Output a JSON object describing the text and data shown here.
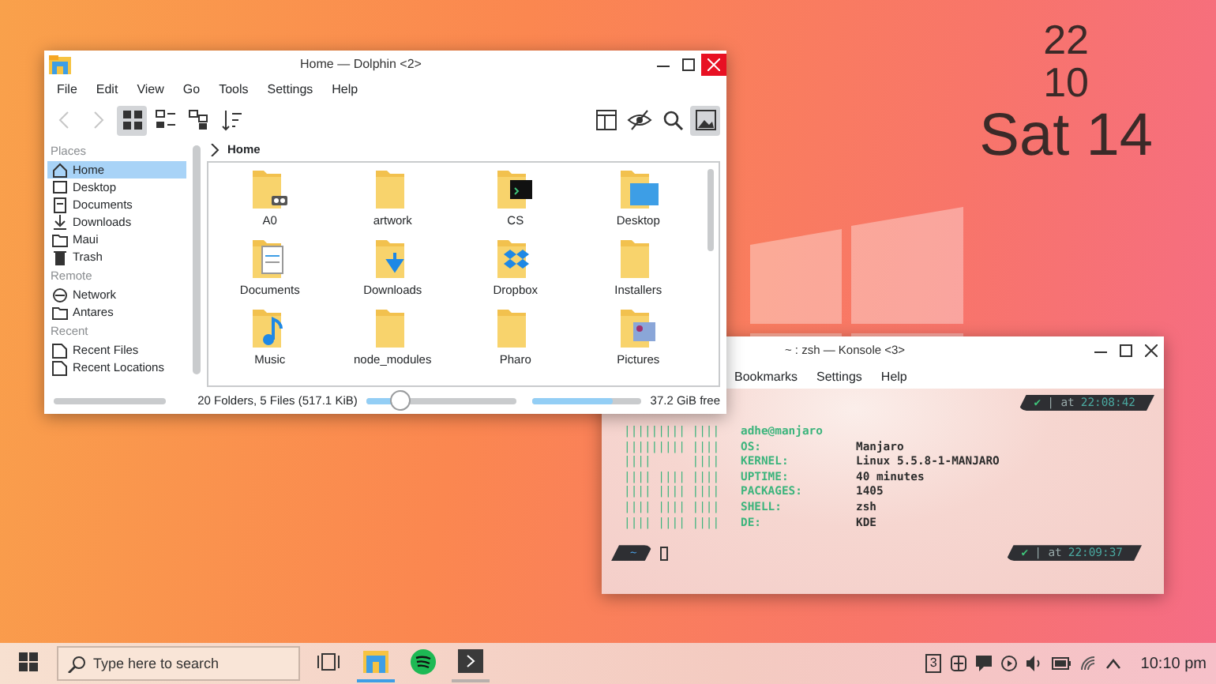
{
  "desktop_clock": {
    "hour": "22",
    "minute": "10",
    "date": "Sat 14"
  },
  "dolphin": {
    "title": "Home — Dolphin <2>",
    "menu": [
      "File",
      "Edit",
      "View",
      "Go",
      "Tools",
      "Settings",
      "Help"
    ],
    "toolbar": [
      {
        "kind": "back",
        "disabled": true,
        "selected": false
      },
      {
        "kind": "forward",
        "disabled": true,
        "selected": false
      },
      {
        "kind": "icons-view",
        "disabled": false,
        "selected": true
      },
      {
        "kind": "compact-view",
        "disabled": false,
        "selected": false
      },
      {
        "kind": "details-view",
        "disabled": false,
        "selected": false
      },
      {
        "kind": "sort",
        "disabled": false,
        "selected": false
      },
      {
        "kind": "spacer"
      },
      {
        "kind": "split",
        "disabled": false,
        "selected": false
      },
      {
        "kind": "hidden",
        "disabled": false,
        "selected": false
      },
      {
        "kind": "search",
        "disabled": false,
        "selected": false
      },
      {
        "kind": "preview",
        "disabled": false,
        "selected": true
      }
    ],
    "places": [
      {
        "heading": "Places",
        "items": [
          {
            "label": "Home",
            "kind": "home",
            "selected": true
          },
          {
            "label": "Desktop",
            "kind": "desktop",
            "selected": false
          },
          {
            "label": "Documents",
            "kind": "documents",
            "selected": false
          },
          {
            "label": "Downloads",
            "kind": "downloads",
            "selected": false
          },
          {
            "label": "Maui",
            "kind": "folder",
            "selected": false
          },
          {
            "label": "Trash",
            "kind": "trash",
            "selected": false
          }
        ]
      },
      {
        "heading": "Remote",
        "items": [
          {
            "label": "Network",
            "kind": "network",
            "selected": false
          },
          {
            "label": "Antares",
            "kind": "folder",
            "selected": false
          }
        ]
      },
      {
        "heading": "Recent",
        "items": [
          {
            "label": "Recent Files",
            "kind": "recent",
            "selected": false
          },
          {
            "label": "Recent Locations",
            "kind": "recent",
            "selected": false
          }
        ]
      }
    ],
    "breadcrumb": "Home",
    "files": [
      {
        "name": "A0",
        "kind": "archive"
      },
      {
        "name": "artwork",
        "kind": "folder"
      },
      {
        "name": "CS",
        "kind": "terminal"
      },
      {
        "name": "Desktop",
        "kind": "desktop"
      },
      {
        "name": "Documents",
        "kind": "documents"
      },
      {
        "name": "Downloads",
        "kind": "downloads"
      },
      {
        "name": "Dropbox",
        "kind": "dropbox"
      },
      {
        "name": "Installers",
        "kind": "folder"
      },
      {
        "name": "Music",
        "kind": "music"
      },
      {
        "name": "node_modules",
        "kind": "folder"
      },
      {
        "name": "Pharo",
        "kind": "folder"
      },
      {
        "name": "Pictures",
        "kind": "pictures"
      }
    ],
    "status": "20 Folders, 5 Files (517.1 KiB)",
    "zoom": {
      "level": 0.22
    },
    "free_space": {
      "level": 0.75,
      "label": "37.2 GiB free"
    }
  },
  "konsole": {
    "title": "~ : zsh — Konsole <3>",
    "menu": [
      "Bookmarks",
      "Settings",
      "Help"
    ],
    "first_prompt": {
      "status": "✔",
      "text": "| at",
      "time": "22:08:42"
    },
    "neofetch": [
      {
        "logo": "||||||||| ||||",
        "key": "adhe@manjaro"
      },
      {
        "logo": "||||||||| ||||",
        "key": "OS:",
        "value": "Manjaro"
      },
      {
        "logo": "||||      ||||",
        "key": "KERNEL:",
        "value": "Linux 5.5.8-1-MANJARO"
      },
      {
        "logo": "|||| |||| ||||",
        "key": "UPTIME:",
        "value": "40 minutes"
      },
      {
        "logo": "|||| |||| ||||",
        "key": "PACKAGES:",
        "value": "1405"
      },
      {
        "logo": "|||| |||| ||||",
        "key": "SHELL:",
        "value": "zsh"
      },
      {
        "logo": "|||| |||| ||||",
        "key": "DE:",
        "value": "KDE"
      }
    ],
    "last_prompt": {
      "path": "~",
      "status": "✔",
      "text": "| at",
      "time": "22:09:37"
    }
  },
  "taskbar": {
    "search": {
      "placeholder": "Type here to search"
    },
    "apps": [
      {
        "kind": "files",
        "running": true,
        "active": true
      },
      {
        "kind": "music",
        "running": false,
        "active": false
      },
      {
        "kind": "terminal",
        "running": true,
        "active": false
      }
    ],
    "tray": {
      "badge": "3",
      "clock": "10:10 pm"
    }
  }
}
